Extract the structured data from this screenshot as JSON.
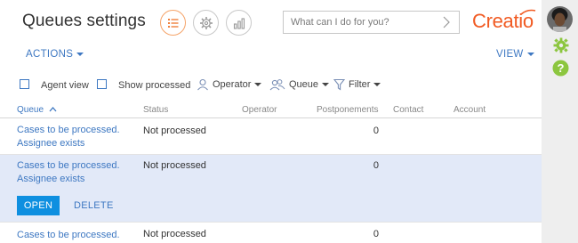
{
  "header": {
    "title": "Queues settings",
    "search_placeholder": "What can I do for you?",
    "logo": "Creatio"
  },
  "actions": {
    "actions_label": "ACTIONS",
    "view_label": "VIEW"
  },
  "filters": {
    "agent_view": "Agent view",
    "show_processed": "Show processed",
    "operator": "Operator",
    "queue": "Queue",
    "filter": "Filter"
  },
  "columns": [
    "Queue",
    "Status",
    "Operator",
    "Postponements",
    "Contact",
    "Account"
  ],
  "rows": [
    {
      "queue_line1": "Cases to be processed.",
      "queue_line2": "Assignee exists",
      "status": "Not processed",
      "postponements": "0"
    },
    {
      "queue_line1": "Cases to be processed.",
      "queue_line2": "Assignee exists",
      "status": "Not processed",
      "postponements": "0"
    },
    {
      "queue_line1": "Cases to be processed.",
      "queue_line2": "",
      "status": "Not processed",
      "postponements": "0"
    }
  ],
  "row_actions": {
    "open": "OPEN",
    "delete": "DELETE"
  },
  "colors": {
    "accent": "#3e78c2",
    "brand": "#f15a22",
    "selected_row": "#e2e9f8",
    "open_button": "#0e8fe0"
  }
}
